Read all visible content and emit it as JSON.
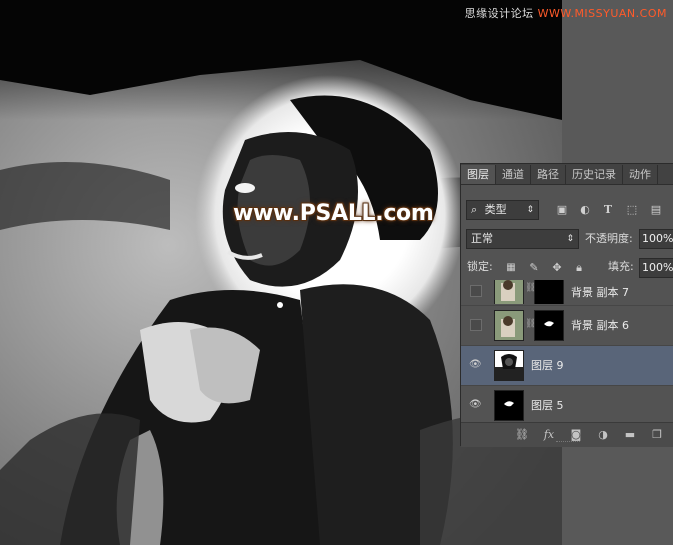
{
  "watermark_top": {
    "prefix": "思缘设计论坛",
    "site": "WWW.MISSYUAN.COM"
  },
  "watermark_center": "www.PSALL.com",
  "layers_panel": {
    "tabs": [
      "图层",
      "通道",
      "路径",
      "历史记录",
      "动作"
    ],
    "active_tab": "图层",
    "filter": {
      "icon": "search-icon",
      "label": "类型"
    },
    "blend_mode": "正常",
    "opacity_label": "不透明度:",
    "opacity_value": "100%",
    "lock_label": "锁定:",
    "fill_label": "填充:",
    "fill_value": "100%",
    "layers": [
      {
        "name": "背景 副本 7",
        "visible": false,
        "has_mask": true
      },
      {
        "name": "背景 副本 6",
        "visible": false,
        "has_mask": true
      },
      {
        "name": "图层 9",
        "visible": true,
        "selected": true,
        "has_mask": false
      },
      {
        "name": "图层 5",
        "visible": true,
        "has_mask": false
      }
    ],
    "selected_color": "#596579"
  }
}
